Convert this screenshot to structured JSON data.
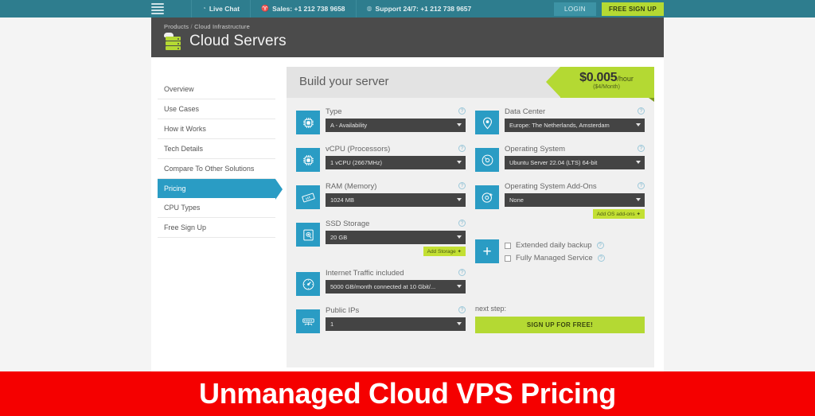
{
  "topbar": {
    "menu_icon": "hamburger-icon",
    "items": [
      {
        "icon": "chat-icon",
        "label": "Live Chat"
      },
      {
        "icon": "cart-icon",
        "label": "Sales: +1 212 738 9658"
      },
      {
        "icon": "headset-icon",
        "label": "Support 24/7: +1 212 738 9657"
      }
    ],
    "login_label": "LOGIN",
    "signup_label": "FREE SIGN UP",
    "bg_color": "#2e7d8e",
    "accent_green": "#b4d933"
  },
  "product_header": {
    "breadcrumb_root": "Products",
    "breadcrumb_sep": "/",
    "breadcrumb_current": "Cloud Infrastructure",
    "title": "Cloud Servers",
    "icon": "cloud-server-icon",
    "bg_color": "#4b4b4b"
  },
  "sidebar": {
    "items": [
      {
        "label": "Overview",
        "active": false
      },
      {
        "label": "Use Cases",
        "active": false
      },
      {
        "label": "How it Works",
        "active": false
      },
      {
        "label": "Tech Details",
        "active": false
      },
      {
        "label": "Compare To Other Solutions",
        "active": false
      },
      {
        "label": "Pricing",
        "active": true
      },
      {
        "label": "CPU Types",
        "active": false
      },
      {
        "label": "Free Sign Up",
        "active": false
      }
    ],
    "active_color": "#2a9cc4"
  },
  "builder": {
    "title": "Build your server",
    "price": {
      "amount": "$0.005",
      "per": "/hour",
      "monthly": "($4/Month)",
      "color": "#b4d933"
    },
    "left_fields": [
      {
        "label": "Type",
        "value": "A - Availability",
        "icon": "cpu-chip-icon",
        "help": "?",
        "addon": null
      },
      {
        "label": "vCPU (Processors)",
        "value": "1 vCPU (2667MHz)",
        "icon": "cpu-chip-icon",
        "help": "?",
        "addon": null
      },
      {
        "label": "RAM (Memory)",
        "value": "1024 MB",
        "icon": "ram-stick-icon",
        "help": "?",
        "addon": null
      },
      {
        "label": "SSD Storage",
        "value": "20 GB",
        "icon": "hard-disk-icon",
        "help": "?",
        "addon": "Add Storage ✦"
      },
      {
        "label": "Internet Traffic included",
        "value": "5000 GB/month connected at 10 Gbit/...",
        "icon": "speedometer-icon",
        "help": "?",
        "addon": null
      },
      {
        "label": "Public IPs",
        "value": "1",
        "icon": "network-switch-icon",
        "help": "?",
        "addon": null
      }
    ],
    "right_fields": [
      {
        "label": "Data Center",
        "value": "Europe: The Netherlands, Amsterdam",
        "icon": "map-pin-icon",
        "help": "?",
        "addon": null
      },
      {
        "label": "Operating System",
        "value": "Ubuntu Server 22.04 (LTS) 64-bit",
        "icon": "disc-icon",
        "help": "?",
        "addon": null
      },
      {
        "label": "Operating System Add-Ons",
        "value": "None",
        "icon": "disc-plus-icon",
        "help": "?",
        "addon": "Add OS add-ons ✦"
      }
    ],
    "checkboxes": {
      "icon": "plus-icon",
      "items": [
        {
          "label": "Extended daily backup",
          "checked": false,
          "help": "?"
        },
        {
          "label": "Fully Managed Service",
          "checked": false,
          "help": "?"
        }
      ]
    },
    "next_step_label": "next step:",
    "signup_button": "SIGN UP FOR FREE!"
  },
  "banner": {
    "text": "Unmanaged Cloud VPS Pricing",
    "bg_color": "#f50000"
  }
}
